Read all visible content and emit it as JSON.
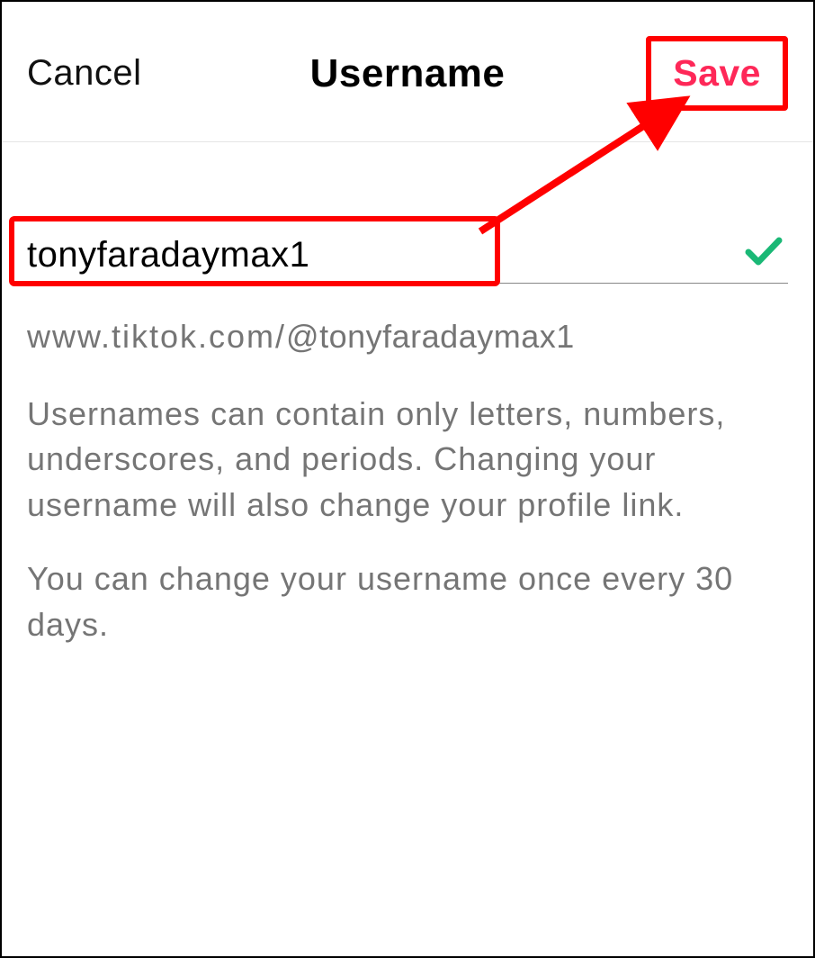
{
  "header": {
    "cancel_label": "Cancel",
    "title": "Username",
    "save_label": "Save"
  },
  "form": {
    "username_value": "tonyfaradaymax1",
    "url_prefix": "www.tiktok.com/",
    "url_at": "@tonyfaradaymax1",
    "validation_icon": "checkmark-icon"
  },
  "help": {
    "paragraph1": "Usernames can contain only letters, numbers, underscores, and periods. Changing your username will also change your profile link.",
    "paragraph2": "You can change your username once every 30 days."
  },
  "annotation": {
    "highlight_color": "#ff0000",
    "accent_color": "#fe2858",
    "check_color": "#1ab876"
  }
}
